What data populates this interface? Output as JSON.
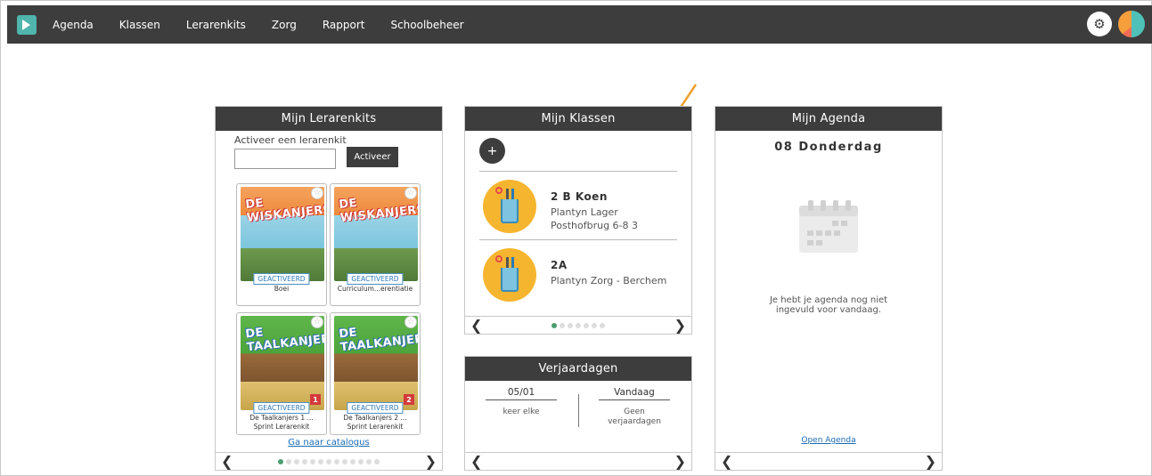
{
  "nav": {
    "items": [
      "Agenda",
      "Klassen",
      "Lerarenkits",
      "Zorg",
      "Rapport",
      "Schoolbeheer"
    ]
  },
  "icons": {
    "logo": "app-logo",
    "settings": "gear-icon",
    "brand": "brand-logo"
  },
  "lerarenkits": {
    "title": "Mijn Lerarenkits",
    "activate_label": "Activeer een lerarenkit",
    "activate_input_value": "",
    "activate_button": "Activeer",
    "kits": [
      {
        "cover_title": "DE WISKANJERS",
        "badge": "GEACTIVEERD",
        "name": "Boei",
        "number": ""
      },
      {
        "cover_title": "DE WISKANJERS",
        "badge": "GEACTIVEERD",
        "name": "Curriculum...erentiatie",
        "number": ""
      },
      {
        "cover_title": "DE TAALKANJERS",
        "badge": "GEACTIVEERD",
        "name": "De Taalkanjers 1 ... Sprint Lerarenkit",
        "number": "1"
      },
      {
        "cover_title": "DE TAALKANJERS",
        "badge": "GEACTIVEERD",
        "name": "De Taalkanjers 2 ... Sprint Lerarenkit",
        "number": "2"
      }
    ],
    "catalog_link": "Ga naar catalogus",
    "page_count": 13,
    "active_page": 1
  },
  "klassen": {
    "title": "Mijn Klassen",
    "add_label": "+",
    "classes": [
      {
        "name": "2 B Koen",
        "line1": "Plantyn Lager",
        "line2": "Posthofbrug 6-8 3"
      },
      {
        "name": "2A",
        "line1": "Plantyn Zorg - Berchem",
        "line2": ""
      }
    ],
    "page_count": 7,
    "active_page": 1
  },
  "verjaardagen": {
    "title": "Verjaardagen",
    "left_head": "05/01",
    "left_val": "keer elke",
    "right_head": "Vandaag",
    "right_val": "Geen verjaardagen"
  },
  "agenda": {
    "title": "Mijn Agenda",
    "date": "08 Donderdag",
    "message": "Je hebt je agenda nog niet ingevuld voor vandaag.",
    "open_link": "Open Agenda"
  },
  "colors": {
    "topbar": "#3d3d3d",
    "accent_teal": "#4fb5ad",
    "link": "#1a6bb3",
    "arrow": "#f0a030",
    "dot_active": "#4a9e6e"
  }
}
